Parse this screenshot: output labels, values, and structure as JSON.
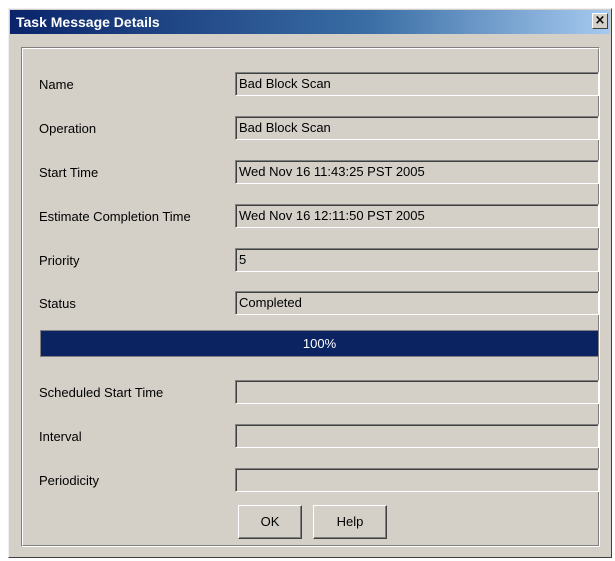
{
  "window": {
    "title": "Task Message Details",
    "close_glyph": "×"
  },
  "fields": [
    {
      "label": "Name",
      "value": "Bad Block Scan"
    },
    {
      "label": "Operation",
      "value": "Bad Block Scan"
    },
    {
      "label": "Start Time",
      "value": "Wed Nov 16 11:43:25 PST 2005"
    },
    {
      "label": "Estimate Completion Time",
      "value": "Wed Nov 16 12:11:50 PST 2005"
    },
    {
      "label": "Priority",
      "value": "5"
    },
    {
      "label": "Status",
      "value": "Completed"
    }
  ],
  "progress": {
    "percent": 100,
    "text": "100%",
    "fill_color": "#0b2461"
  },
  "schedule_fields": [
    {
      "label": "Scheduled Start Time",
      "value": ""
    },
    {
      "label": "Interval",
      "value": ""
    },
    {
      "label": "Periodicity",
      "value": ""
    }
  ],
  "buttons": {
    "ok_label": "OK",
    "help_label": "Help"
  }
}
